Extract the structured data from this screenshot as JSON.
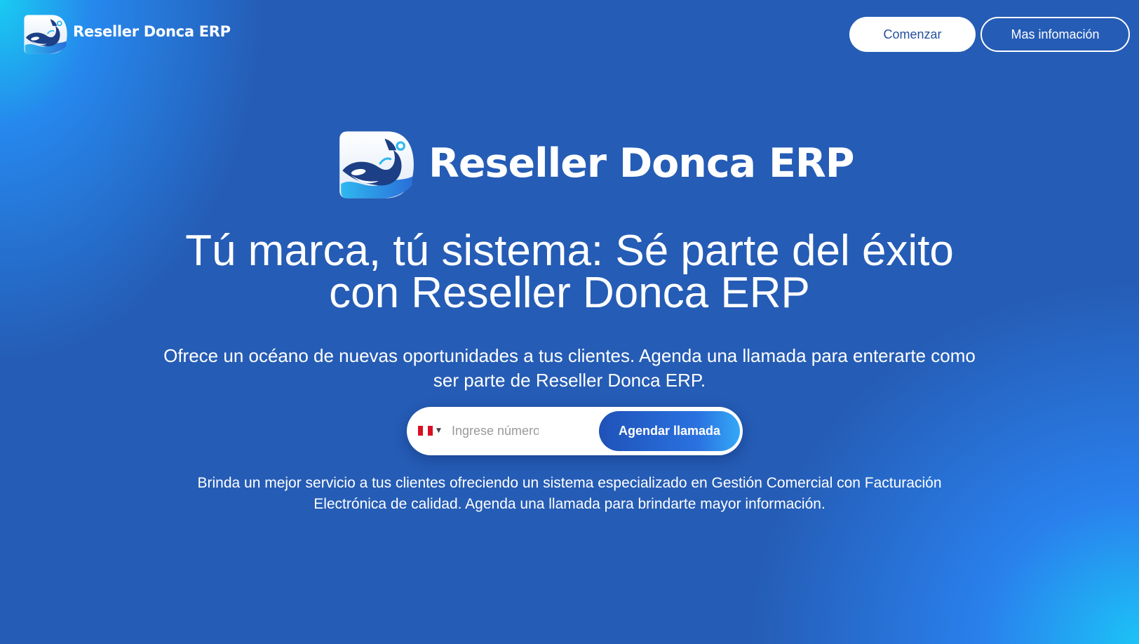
{
  "header": {
    "brand": "Reseller Donca ERP",
    "logo_icon": "orca-whale-logo-icon",
    "start_button": "Comenzar",
    "info_button": "Mas infomación"
  },
  "hero": {
    "brand": "Reseller Donca ERP",
    "headline": "Tú marca, tú sistema: Sé parte del éxito con Reseller Donca ERP",
    "lead": "Ofrece un océano de nuevas oportunidades a tus clientes. Agenda una llamada para enterarte como ser parte de Reseller Donca ERP.",
    "description": "Brinda un mejor servicio a tus clientes ofreciendo un sistema especializado en Gestión Comercial con Facturación Electrónica de calidad. Agenda una llamada para brindarte mayor información."
  },
  "phone_form": {
    "country_flag": "peru-flag-icon",
    "placeholder": "Ingrese número",
    "value": "",
    "submit": "Agendar llamada"
  },
  "colors": {
    "background": "#255cb5",
    "accent_cyan": "#1cc8f5",
    "button_text": "#2450a0",
    "flag_red": "#d91023"
  }
}
